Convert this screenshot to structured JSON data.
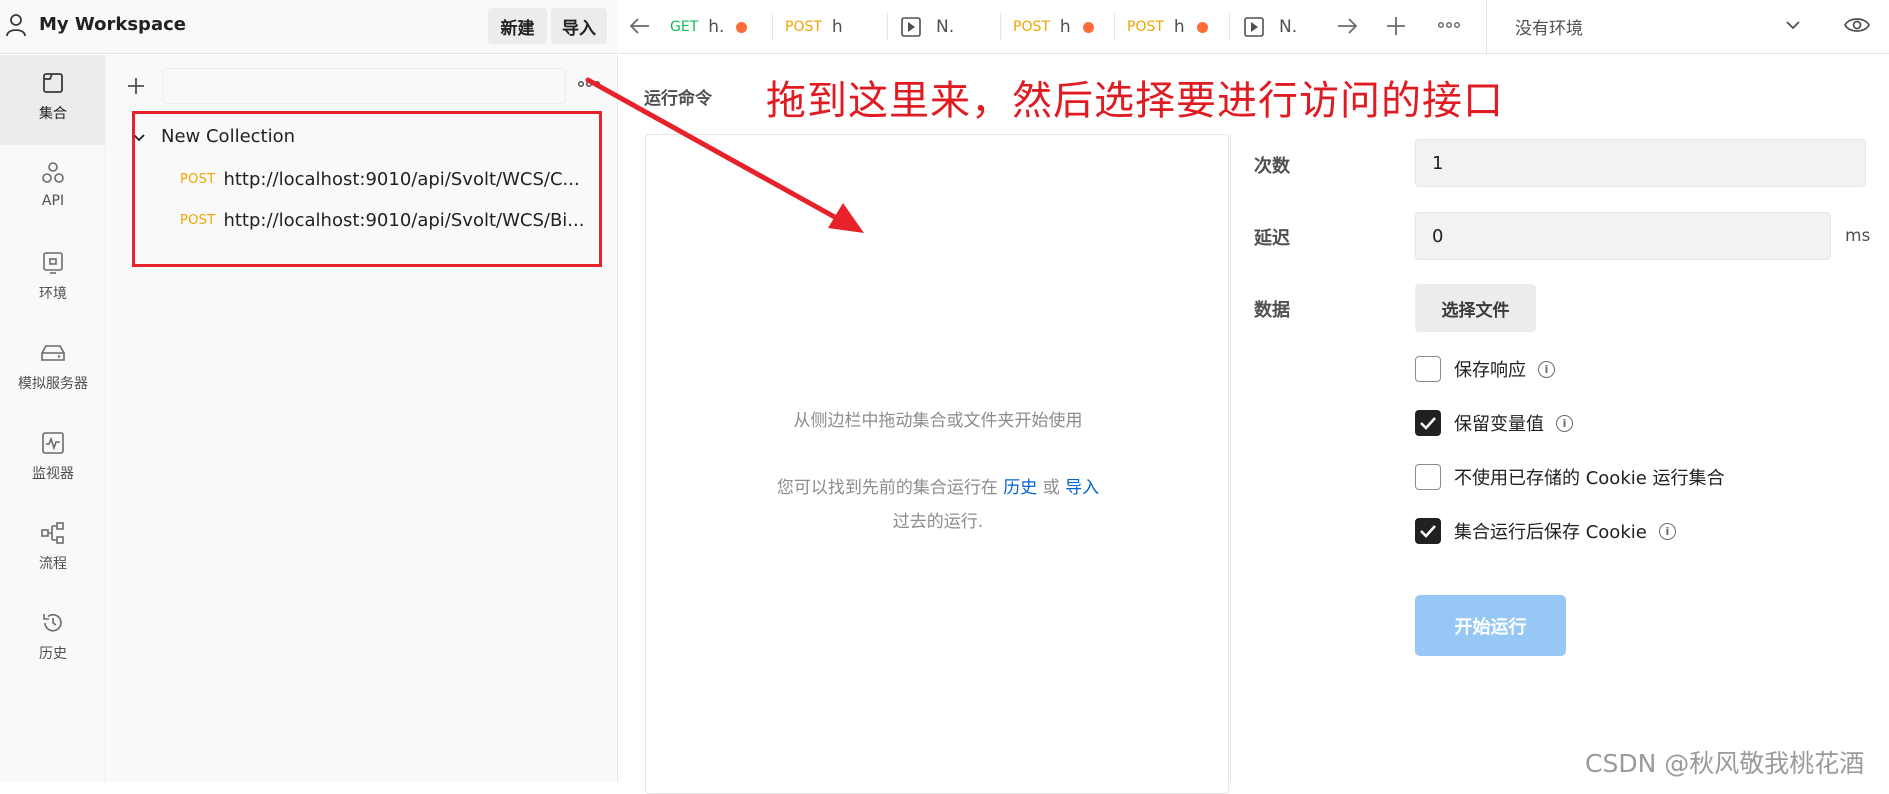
{
  "workspace": {
    "title": "My Workspace",
    "new_label": "新建",
    "import_label": "导入"
  },
  "rail": {
    "items": [
      {
        "label": "集合",
        "icon": "collections-icon",
        "active": true
      },
      {
        "label": "API",
        "icon": "api-icon"
      },
      {
        "label": "环境",
        "icon": "environment-icon"
      },
      {
        "label": "模拟服务器",
        "icon": "mock-server-icon"
      },
      {
        "label": "监视器",
        "icon": "monitor-icon"
      },
      {
        "label": "流程",
        "icon": "flows-icon"
      },
      {
        "label": "历史",
        "icon": "history-icon"
      }
    ]
  },
  "sidebar": {
    "collection_name": "New Collection",
    "requests": [
      {
        "method": "POST",
        "url": "http://localhost:9010/api/Svolt/WCS/C..."
      },
      {
        "method": "POST",
        "url": "http://localhost:9010/api/Svolt/WCS/Bi..."
      }
    ]
  },
  "tabs": [
    {
      "method": "GET",
      "name": "h.",
      "unsaved": true
    },
    {
      "method": "POST",
      "name": "h",
      "unsaved": false
    },
    {
      "method": "",
      "name": "N.",
      "unsaved": false,
      "icon": "runner-icon"
    },
    {
      "method": "POST",
      "name": "h",
      "unsaved": true
    },
    {
      "method": "POST",
      "name": "h",
      "unsaved": true
    },
    {
      "method": "",
      "name": "N.",
      "unsaved": false,
      "icon": "runner-icon"
    }
  ],
  "environment": {
    "selected": "没有环境"
  },
  "runner": {
    "title": "运行命令",
    "annotation": "拖到这里来，然后选择要进行访问的接口",
    "empty_line1": "从侧边栏中拖动集合或文件夹开始使用",
    "empty_line2_prefix": "您可以找到先前的集合运行在",
    "empty_link_history": "历史",
    "empty_or": "或",
    "empty_link_import": "导入",
    "empty_line3": "过去的运行.",
    "iterations_label": "次数",
    "iterations_value": "1",
    "delay_label": "延迟",
    "delay_value": "0",
    "delay_unit": "ms",
    "data_label": "数据",
    "select_file": "选择文件",
    "options": [
      {
        "label": "保存响应",
        "checked": false,
        "info": true
      },
      {
        "label": "保留变量值",
        "checked": true,
        "info": true
      },
      {
        "label": "不使用已存储的 Cookie 运行集合",
        "checked": false,
        "info": false
      },
      {
        "label": "集合运行后保存 Cookie",
        "checked": true,
        "info": true
      }
    ],
    "run_button": "开始运行"
  },
  "watermark": "CSDN @秋风敬我桃花酒",
  "colors": {
    "annotation_red": "#e01b22",
    "post": "#f0a400",
    "get": "#0cbb52",
    "dot": "#ff6c37",
    "run_button": "#97c8f5"
  }
}
